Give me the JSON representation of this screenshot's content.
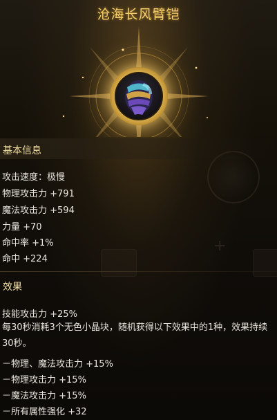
{
  "item": {
    "name": "沧海长风臂铠",
    "icon": "armguard-item-icon"
  },
  "basic_info": {
    "heading": "基本信息",
    "stats": [
      "攻击速度：极慢",
      "物理攻击力 +791",
      "魔法攻击力 +594",
      "力量 +70",
      "命中率 +1%",
      "命中 +224"
    ]
  },
  "effects": {
    "heading": "效果",
    "skill_attack": "技能攻击力 +25%",
    "description": "每30秒消耗3个无色小晶块，随机获得以下效果中的1种，效果持续30秒。",
    "options": [
      "－物理、魔法攻击力 +15%",
      "－物理攻击力 +15%",
      "－魔法攻击力 +15%",
      "－所有属性强化 +32"
    ]
  },
  "colors": {
    "title": "#f5cf6a",
    "heading": "#f2dfa5",
    "text": "#e9e5de"
  }
}
